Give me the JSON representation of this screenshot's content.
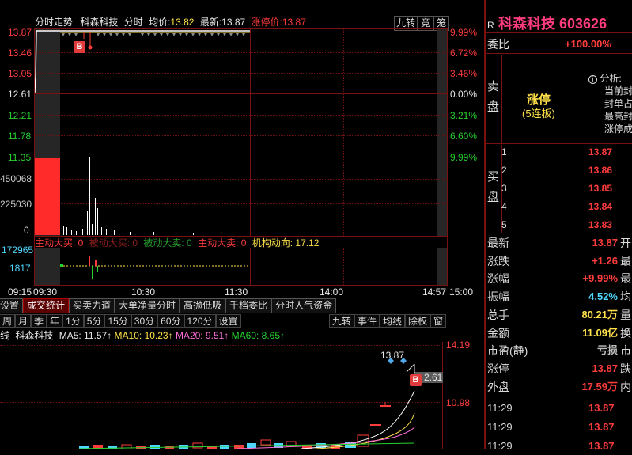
{
  "intraday": {
    "title_tab": "分时走势",
    "stock_name": "科森科技",
    "mode": "分时",
    "avg_label": "均价:",
    "avg_price": "13.82",
    "latest_label": "最新:",
    "latest_price": "13.87",
    "limit_label": "涨停价:",
    "limit_price": "13.87",
    "top_buttons": [
      "九转",
      "竞",
      "笼"
    ],
    "price_axis": [
      "13.87",
      "13.46",
      "13.05",
      "12.61",
      "12.21",
      "11.78",
      "11.35"
    ],
    "pct_axis": [
      "9.99%",
      "6.72%",
      "3.46%",
      "0.00%",
      "3.21%",
      "6.60%",
      "9.99%"
    ],
    "vol_axis": [
      "450068",
      "225030",
      "0"
    ],
    "buy_marker": "B",
    "flow_labels": {
      "active_buy": "主动大买: 0",
      "passive_buy": "被动大买: 0",
      "passive_sell": "被动大卖: 0",
      "active_sell": "主动大卖: 0",
      "inst": "机构动向: 17.12"
    },
    "flow_axis": [
      "172965",
      "1817"
    ],
    "time_axis": [
      "09:15",
      "09:30",
      "10:30",
      "11:30",
      "14:00",
      "14:57",
      "15:00"
    ]
  },
  "colors": {
    "red": "#ff3c3c",
    "green": "#27d12e",
    "grid": "#6a1010",
    "gray": "#2c2c2c"
  },
  "sub_tabs": [
    "设置",
    "成交统计",
    "买卖力道",
    "大单净量分时",
    "高抛低吸",
    "千档委比",
    "分时人气资金"
  ],
  "active_sub_tab": "成交统计",
  "period_bar": [
    "周",
    "月",
    "季",
    "年",
    "1分",
    "5分",
    "15分",
    "30分",
    "60分",
    "120分",
    "设置"
  ],
  "period_right": [
    "九转",
    "事件",
    "均线",
    "除权",
    "窗"
  ],
  "kline": {
    "type_label": "线",
    "name": "科森科技",
    "ma5": "MA5: 11.57↑",
    "ma10": "MA10: 10.23↑",
    "ma20": "MA20: 9.51↑",
    "ma60": "MA60: 8.65↑",
    "axis": [
      "14.19",
      "10.98"
    ],
    "high_label": "13.87",
    "low_label": "2.61",
    "buy_marker": "B"
  },
  "quote": {
    "r_label": "R",
    "name_code": "科森科技 603626",
    "webi_label": "委比",
    "webi_value": "+100.00%",
    "sell_label": [
      "卖",
      "盘"
    ],
    "buy_label": [
      "买",
      "盘"
    ],
    "limit_status": "涨停",
    "streak": "(5连板)",
    "analysis_title": "分析:",
    "analysis_lines": [
      "当前封",
      "封单占",
      "最高封",
      "涨停成"
    ],
    "bids": [
      {
        "n": "1",
        "p": "13.87"
      },
      {
        "n": "2",
        "p": "13.86"
      },
      {
        "n": "3",
        "p": "13.85"
      },
      {
        "n": "4",
        "p": "13.84"
      },
      {
        "n": "5",
        "p": "13.83"
      }
    ],
    "stats": [
      {
        "k": "最新",
        "v": "13.87",
        "k2": "开",
        "color": "#ff3c3c"
      },
      {
        "k": "涨跌",
        "v": "+1.26",
        "k2": "最",
        "color": "#ff3c3c"
      },
      {
        "k": "涨幅",
        "v": "+9.99%",
        "k2": "最",
        "color": "#ff3c3c"
      },
      {
        "k": "振幅",
        "v": "4.52%",
        "k2": "均",
        "color": "#4fd8ff"
      },
      {
        "k": "总手",
        "v": "80.21万",
        "k2": "量",
        "color": "#ffe14a"
      },
      {
        "k": "金额",
        "v": "11.09亿",
        "k2": "换",
        "color": "#ffe14a"
      },
      {
        "k": "市盈(静)",
        "v": "亏损",
        "k2": "市",
        "color": "#c0c0c0"
      },
      {
        "k": "涨停",
        "v": "13.87",
        "k2": "跌",
        "color": "#ff3c3c"
      },
      {
        "k": "外盘",
        "v": "17.59万",
        "k2": "内",
        "color": "#ff3c3c"
      }
    ],
    "ticks": [
      {
        "t": "11:29",
        "p": "13.87"
      },
      {
        "t": "11:29",
        "p": "13.87"
      },
      {
        "t": "11:29",
        "p": "13.87"
      }
    ]
  }
}
